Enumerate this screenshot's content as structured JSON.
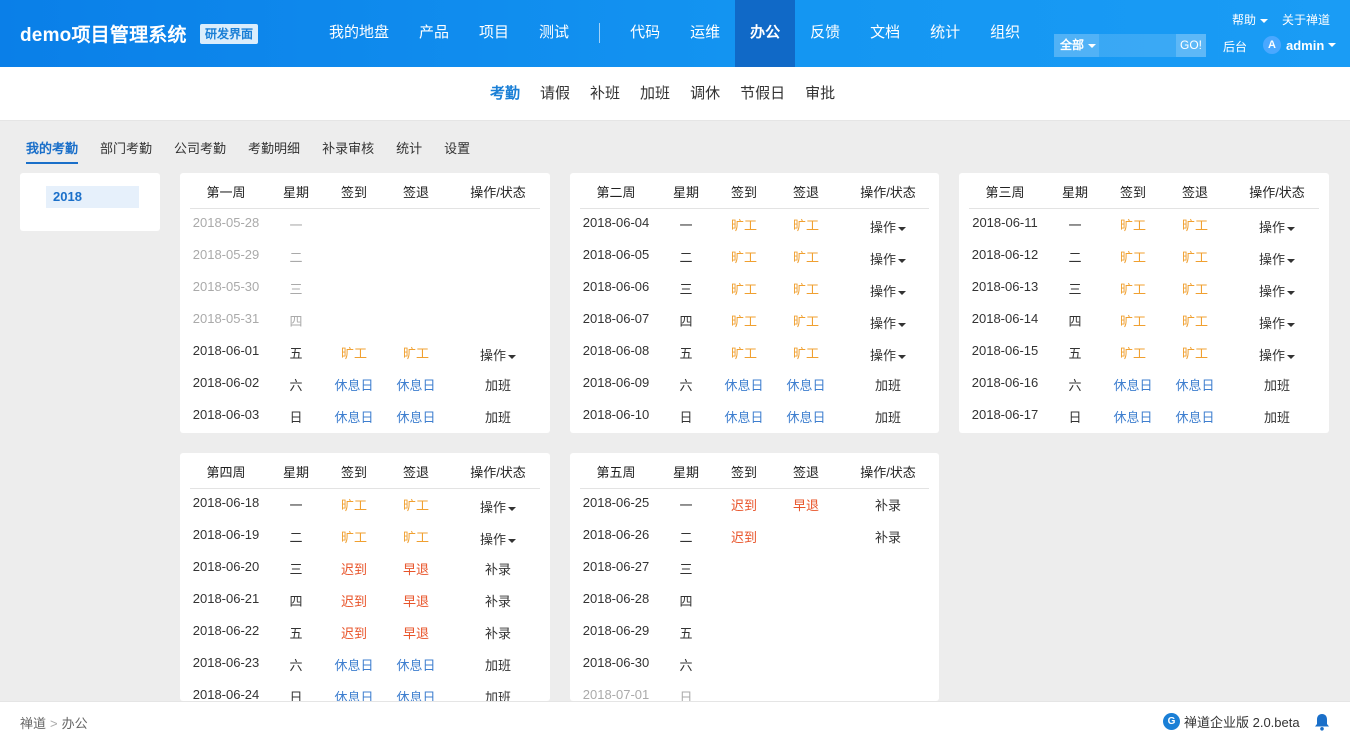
{
  "header": {
    "brand": "demo项目管理系统",
    "brand_tag": "研发界面",
    "nav_left": [
      "我的地盘",
      "产品",
      "项目",
      "测试"
    ],
    "nav_right": [
      "代码",
      "运维",
      "办公",
      "反馈",
      "文档",
      "统计",
      "组织"
    ],
    "active_nav": "办公",
    "help": "帮助",
    "about": "关于禅道",
    "search_scope": "全部",
    "search_value": "",
    "search_go": "GO!",
    "backend": "后台",
    "avatar_letter": "A",
    "user": "admin"
  },
  "subnav": {
    "items": [
      "考勤",
      "请假",
      "补班",
      "加班",
      "调休",
      "节假日",
      "审批"
    ],
    "active": "考勤"
  },
  "tabs": {
    "items": [
      "我的考勤",
      "部门考勤",
      "公司考勤",
      "考勤明细",
      "补录审核",
      "统计",
      "设置"
    ],
    "active": "我的考勤"
  },
  "year": "2018",
  "columns": {
    "day": "星期",
    "signin": "签到",
    "signout": "签退",
    "action": "操作/状态"
  },
  "weeks": [
    {
      "title": "第一周",
      "rows": [
        {
          "date": "2018-05-28",
          "day": "一",
          "in": "",
          "out": "",
          "act": "",
          "state": "muted"
        },
        {
          "date": "2018-05-29",
          "day": "二",
          "in": "",
          "out": "",
          "act": "",
          "state": "muted"
        },
        {
          "date": "2018-05-30",
          "day": "三",
          "in": "",
          "out": "",
          "act": "",
          "state": "muted"
        },
        {
          "date": "2018-05-31",
          "day": "四",
          "in": "",
          "out": "",
          "act": "",
          "state": "muted"
        },
        {
          "date": "2018-06-01",
          "day": "五",
          "in": "旷工",
          "out": "旷工",
          "act": "操作",
          "state": "absent"
        },
        {
          "date": "2018-06-02",
          "day": "六",
          "in": "休息日",
          "out": "休息日",
          "act": "加班",
          "state": "rest"
        },
        {
          "date": "2018-06-03",
          "day": "日",
          "in": "休息日",
          "out": "休息日",
          "act": "加班",
          "state": "rest"
        }
      ]
    },
    {
      "title": "第二周",
      "rows": [
        {
          "date": "2018-06-04",
          "day": "一",
          "in": "旷工",
          "out": "旷工",
          "act": "操作",
          "state": "absent"
        },
        {
          "date": "2018-06-05",
          "day": "二",
          "in": "旷工",
          "out": "旷工",
          "act": "操作",
          "state": "absent"
        },
        {
          "date": "2018-06-06",
          "day": "三",
          "in": "旷工",
          "out": "旷工",
          "act": "操作",
          "state": "absent"
        },
        {
          "date": "2018-06-07",
          "day": "四",
          "in": "旷工",
          "out": "旷工",
          "act": "操作",
          "state": "absent"
        },
        {
          "date": "2018-06-08",
          "day": "五",
          "in": "旷工",
          "out": "旷工",
          "act": "操作",
          "state": "absent"
        },
        {
          "date": "2018-06-09",
          "day": "六",
          "in": "休息日",
          "out": "休息日",
          "act": "加班",
          "state": "rest"
        },
        {
          "date": "2018-06-10",
          "day": "日",
          "in": "休息日",
          "out": "休息日",
          "act": "加班",
          "state": "rest"
        }
      ]
    },
    {
      "title": "第三周",
      "rows": [
        {
          "date": "2018-06-11",
          "day": "一",
          "in": "旷工",
          "out": "旷工",
          "act": "操作",
          "state": "absent"
        },
        {
          "date": "2018-06-12",
          "day": "二",
          "in": "旷工",
          "out": "旷工",
          "act": "操作",
          "state": "absent"
        },
        {
          "date": "2018-06-13",
          "day": "三",
          "in": "旷工",
          "out": "旷工",
          "act": "操作",
          "state": "absent"
        },
        {
          "date": "2018-06-14",
          "day": "四",
          "in": "旷工",
          "out": "旷工",
          "act": "操作",
          "state": "absent"
        },
        {
          "date": "2018-06-15",
          "day": "五",
          "in": "旷工",
          "out": "旷工",
          "act": "操作",
          "state": "absent"
        },
        {
          "date": "2018-06-16",
          "day": "六",
          "in": "休息日",
          "out": "休息日",
          "act": "加班",
          "state": "rest"
        },
        {
          "date": "2018-06-17",
          "day": "日",
          "in": "休息日",
          "out": "休息日",
          "act": "加班",
          "state": "rest"
        }
      ]
    },
    {
      "title": "第四周",
      "rows": [
        {
          "date": "2018-06-18",
          "day": "一",
          "in": "旷工",
          "out": "旷工",
          "act": "操作",
          "state": "absent"
        },
        {
          "date": "2018-06-19",
          "day": "二",
          "in": "旷工",
          "out": "旷工",
          "act": "操作",
          "state": "absent"
        },
        {
          "date": "2018-06-20",
          "day": "三",
          "in": "迟到",
          "out": "早退",
          "act": "补录",
          "state": "late"
        },
        {
          "date": "2018-06-21",
          "day": "四",
          "in": "迟到",
          "out": "早退",
          "act": "补录",
          "state": "late"
        },
        {
          "date": "2018-06-22",
          "day": "五",
          "in": "迟到",
          "out": "早退",
          "act": "补录",
          "state": "late"
        },
        {
          "date": "2018-06-23",
          "day": "六",
          "in": "休息日",
          "out": "休息日",
          "act": "加班",
          "state": "rest"
        },
        {
          "date": "2018-06-24",
          "day": "日",
          "in": "休息日",
          "out": "休息日",
          "act": "加班",
          "state": "rest"
        }
      ]
    },
    {
      "title": "第五周",
      "rows": [
        {
          "date": "2018-06-25",
          "day": "一",
          "in": "迟到",
          "out": "早退",
          "act": "补录",
          "state": "late"
        },
        {
          "date": "2018-06-26",
          "day": "二",
          "in": "迟到",
          "out": "",
          "act": "补录",
          "state": "late"
        },
        {
          "date": "2018-06-27",
          "day": "三",
          "in": "",
          "out": "",
          "act": "",
          "state": "plain"
        },
        {
          "date": "2018-06-28",
          "day": "四",
          "in": "",
          "out": "",
          "act": "",
          "state": "plain"
        },
        {
          "date": "2018-06-29",
          "day": "五",
          "in": "",
          "out": "",
          "act": "",
          "state": "plain"
        },
        {
          "date": "2018-06-30",
          "day": "六",
          "in": "",
          "out": "",
          "act": "",
          "state": "plain"
        },
        {
          "date": "2018-07-01",
          "day": "日",
          "in": "",
          "out": "",
          "act": "",
          "state": "muted"
        }
      ]
    }
  ],
  "footer": {
    "crumb_root": "禅道",
    "crumb_current": "办公",
    "logo_letter": "G",
    "version": "禅道企业版 2.0.beta"
  },
  "colors": {
    "brand_blue": "#1496f2",
    "active_nav_bg": "#1069c7",
    "absent": "#f0a030",
    "late": "#e8542a",
    "rest": "#3f7fcf",
    "muted": "#aaaaaa"
  }
}
